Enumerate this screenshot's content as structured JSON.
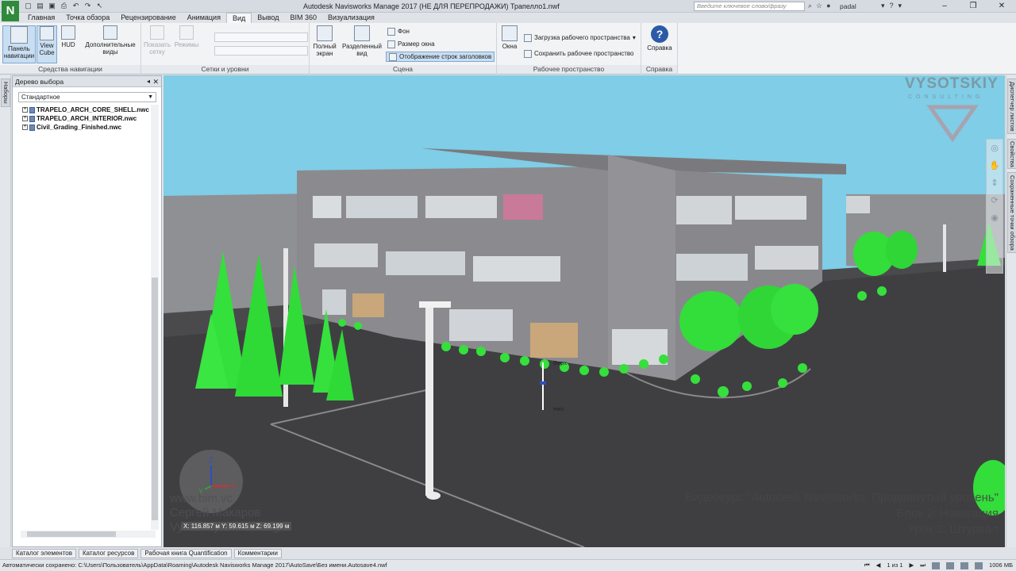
{
  "app": {
    "logo_letter": "N",
    "window_title": "Autodesk Navisworks Manage 2017 (НЕ ДЛЯ ПЕРЕПРОДАЖИ)    Трапелло1.nwf",
    "search_placeholder": "Введите ключевое слово/фразу",
    "user": "padal"
  },
  "tabs": [
    {
      "label": "Главная"
    },
    {
      "label": "Точка обзора"
    },
    {
      "label": "Рецензирование"
    },
    {
      "label": "Анимация"
    },
    {
      "label": "Вид",
      "active": true
    },
    {
      "label": "Вывод"
    },
    {
      "label": "BIM 360"
    },
    {
      "label": "Визуализация"
    }
  ],
  "ribbon": {
    "nav": {
      "label": "Средства навигации",
      "panel_btn": "Панель навигации",
      "viewcube_btn": "View Cube",
      "hud_btn": "HUD",
      "extra_btn": "Дополнительные виды"
    },
    "grids": {
      "label": "Сетки и уровни",
      "show_grid": "Показать сетку",
      "modes": "Режимы"
    },
    "scene": {
      "label": "Сцена",
      "fullscreen": "Полный экран",
      "split": "Разделенный вид",
      "background": "Фон",
      "window_size": "Размер окна",
      "headers": "Отображение строк заголовков"
    },
    "workspace": {
      "label": "Рабочее пространство",
      "windows": "Окна",
      "load": "Загрузка рабочего пространства",
      "save": "Сохранить рабочее пространство"
    },
    "help": {
      "label": "Справка",
      "btn": "Справка",
      "icon_char": "?"
    }
  },
  "left_tabs": {
    "sets": "Наборы"
  },
  "selection_tree": {
    "title": "Дерево выбора",
    "mode": "Стандартное",
    "items": [
      {
        "name": "TRAPELO_ARCH_CORE_SHELL.nwc"
      },
      {
        "name": "TRAPELO_ARCH_INTERIOR.nwc"
      },
      {
        "name": "Civil_Grading_Finished.nwc"
      }
    ]
  },
  "right_tabs": {
    "sheets": "Диспетчер листов",
    "props": "Свойства",
    "saved": "Сохраненные точки обзора"
  },
  "viewport": {
    "watermark_brand": "VYSOTSKIY",
    "watermark_sub": "CONSULTING",
    "course_lines": [
      "Видеокурс \"Autodesk Navisworks: Продвинутый уровень\"",
      "Блок 2: Навигация",
      "Урок 3: Штурвал"
    ],
    "author_lines": [
      "www.bim.vc",
      "Сергей Макаров",
      "Vysotskiy Consulting"
    ],
    "coords": "X: 116.857 м  Y: 59.615 м  Z: 69.199 м",
    "label_top": "Верх",
    "label_bottom": "Низ",
    "axis_z": "Z",
    "axis_x": "X",
    "axis_y": "Y"
  },
  "bottom_tabs": [
    {
      "label": "Каталог элементов"
    },
    {
      "label": "Каталог ресурсов"
    },
    {
      "label": "Рабочая книга Quantification"
    },
    {
      "label": "Комментарии"
    }
  ],
  "status": {
    "autosave": "Автоматически сохранено: C:\\Users\\Пользователь\\AppData\\Roaming\\Autodesk Navisworks Manage 2017\\AutoSave\\Без имени.Autosave4.nwf",
    "page": "1 из 1",
    "memory": "1006 МБ"
  },
  "colors": {
    "sky": "#7fcde6",
    "ground": "#4a4a4d",
    "building": "#8a8a8e",
    "trees": "#33e03a",
    "accent": "#2f8a3c"
  }
}
